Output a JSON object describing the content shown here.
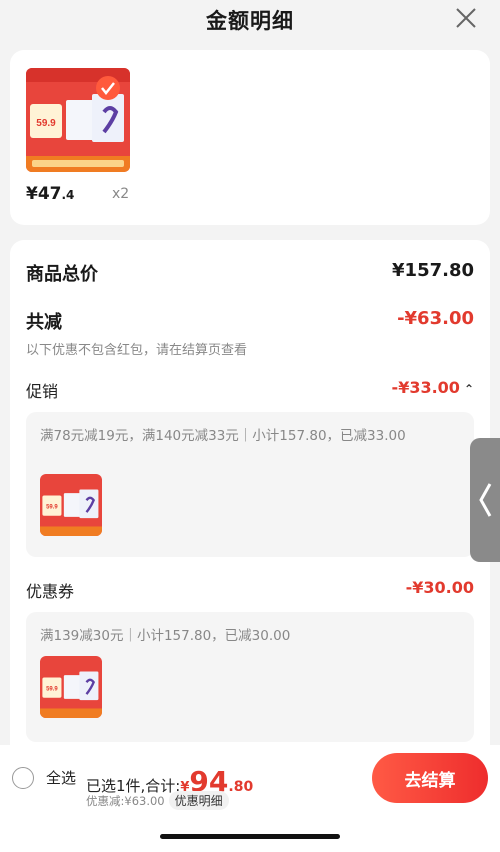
{
  "header": {
    "title": "金额明细",
    "close_icon": "close-icon"
  },
  "product": {
    "image_icon": "milk-product-image",
    "price_main": "¥47",
    "price_decimal": ".4",
    "quantity": "x2"
  },
  "summary": {
    "total_label": "商品总价",
    "total_value": "¥157.80",
    "reduce_label": "共减",
    "reduce_value": "-¥63.00",
    "note": "以下优惠不包含红包，请在结算页查看"
  },
  "promotion": {
    "label": "促销",
    "value": "-¥33.00",
    "detail": "满78元减19元，满140元减33元｜小计157.80，已减33.00"
  },
  "coupon": {
    "label": "优惠券",
    "value": "-¥30.00",
    "detail": "满139减30元｜小计157.80，已减30.00"
  },
  "footer": {
    "select_all": "全选",
    "selected_text": "已选1件,合计:",
    "total_yen": "¥",
    "total_int": "94",
    "total_dec": ".80",
    "discount_text": "优惠减:¥63.00",
    "detail_label": "优惠明细",
    "checkout_label": "去结算"
  },
  "colors": {
    "accent": "#e23a2e",
    "button": "#ee2d2d"
  }
}
